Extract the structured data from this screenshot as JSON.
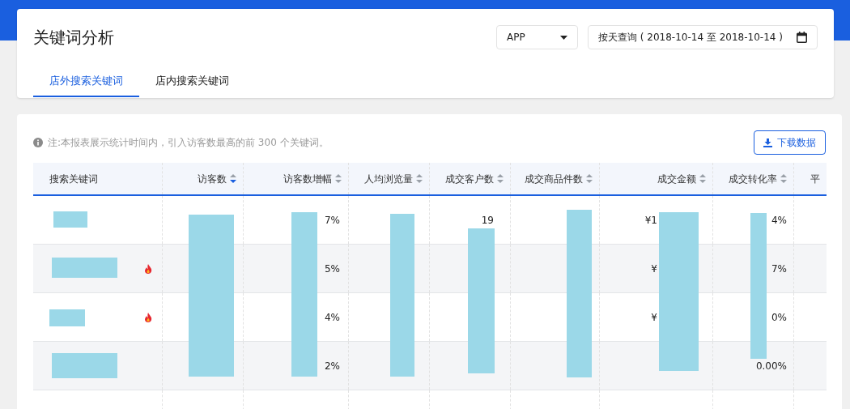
{
  "page": {
    "title": "关键词分析"
  },
  "filters": {
    "platform": "APP",
    "date_range": "按天查询 ( 2018-10-14 至 2018-10-14 )"
  },
  "tabs": [
    {
      "label": "店外搜索关键词",
      "selected": true
    },
    {
      "label": "店内搜索关键词",
      "selected": false
    }
  ],
  "note": "注:本报表展示统计时间内，引入访客数最高的前 300 个关键词。",
  "download_button": "下载数据",
  "table": {
    "columns": [
      {
        "label": "搜索关键词"
      },
      {
        "label": "访客数",
        "sorted": true
      },
      {
        "label": "访客数增幅",
        "sorted": false
      },
      {
        "label": "人均浏览量",
        "sorted": false
      },
      {
        "label": "成交客户数",
        "sorted": false
      },
      {
        "label": "成交商品件数",
        "sorted": false
      },
      {
        "label": "成交金额",
        "sorted": false
      },
      {
        "label": "成交转化率",
        "sorted": false
      },
      {
        "label": "平"
      }
    ],
    "rows": [
      {
        "hot": false,
        "growth": "7%",
        "buyers": "19",
        "amount": "¥1",
        "rate": "4%"
      },
      {
        "hot": true,
        "growth": "5%",
        "amount": "¥",
        "rate": "7%"
      },
      {
        "hot": true,
        "growth": "4%",
        "amount": "¥",
        "rate": "0%"
      },
      {
        "hot": false,
        "growth": "2%",
        "rate": "0.00%"
      }
    ]
  }
}
